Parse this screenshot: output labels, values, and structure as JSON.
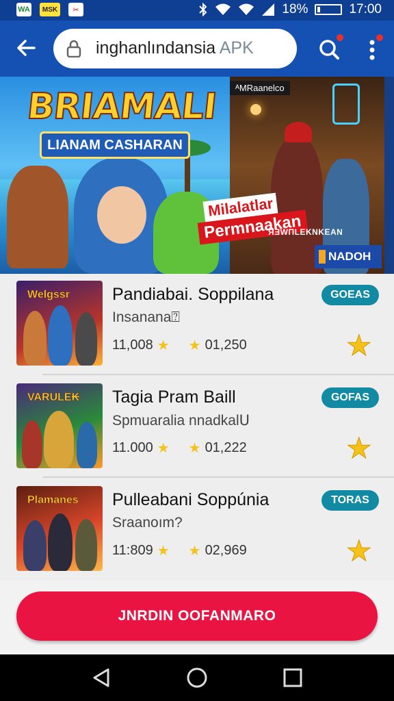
{
  "status_bar": {
    "notif_icons": [
      "WA",
      "MSK",
      "✂"
    ],
    "battery_text": "18%",
    "time": "17:00"
  },
  "app_bar": {
    "search_text": "inghanlındansia",
    "search_suffix": "APK"
  },
  "banner": {
    "game_title": "BRIAMALI",
    "game_subtitle": "LIANAM CASHARAN",
    "tag_label": "ᴬMRaanelco",
    "promo_line1": "Milalatlar",
    "promo_line2": "Permnaakan",
    "caption": "ЯƎWΠLEKNKEAN",
    "brand": "NADOH"
  },
  "list": {
    "items": [
      {
        "thumb_title": "Welgssr",
        "title": "Pandiabai. Soppilana",
        "subtitle": "Insanana⍰",
        "stat1": "11,008",
        "stat2": "01,250",
        "tag": "GOEAS",
        "colors": [
          "#3a1f6a",
          "#b8352a",
          "#ffb13a"
        ]
      },
      {
        "thumb_title": "VARULE₭",
        "title": "Tagia Pram Baill",
        "subtitle": "Spmuaralia nnadkalᑌ",
        "stat1": "11.000",
        "stat2": "01,222",
        "tag": "GOFAS",
        "colors": [
          "#4a2a7a",
          "#2a8a3a",
          "#ff9a2a"
        ]
      },
      {
        "thumb_title": "Plamanes",
        "title": "Pulleabani Soppúnia",
        "subtitle": "Sraanoım?",
        "stat1": "11:809",
        "stat2": "02,969",
        "tag": "TORAS",
        "colors": [
          "#5a1f10",
          "#d8452a",
          "#ffb84a"
        ]
      }
    ]
  },
  "cta": {
    "label": "JNRDIN OOFANMARO"
  },
  "colors": {
    "primary": "#1550b3",
    "accent": "#ea1442",
    "tag": "#128aa3",
    "star": "#f4c21a"
  }
}
